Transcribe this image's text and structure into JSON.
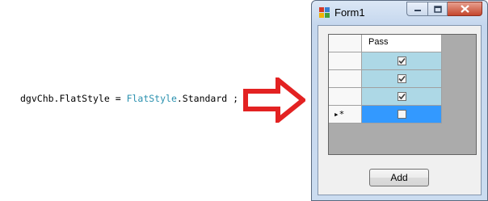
{
  "code": {
    "prefix": "dgvChb.FlatStyle = ",
    "type": "FlatStyle",
    "suffix": ".Standard ;"
  },
  "window": {
    "title": "Form1",
    "icon": "form-icon",
    "buttons": {
      "minimize": "minimize-icon",
      "maximize": "maximize-icon",
      "close": "close-icon"
    }
  },
  "grid": {
    "column_header": "Pass",
    "rows": [
      {
        "checked": true,
        "selected": false,
        "new_row": false
      },
      {
        "checked": true,
        "selected": false,
        "new_row": false
      },
      {
        "checked": true,
        "selected": false,
        "new_row": false
      },
      {
        "checked": false,
        "selected": true,
        "new_row": true
      }
    ],
    "new_row_marker": "▸*"
  },
  "add_button": "Add",
  "colors": {
    "arrow": "#e32222",
    "cell_background": "#add8e6",
    "selected_cell": "#3399ff",
    "code_type": "#2b91af"
  }
}
